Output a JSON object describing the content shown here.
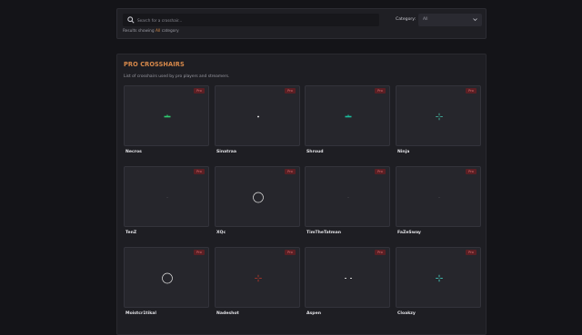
{
  "search": {
    "placeholder": "Search for a crosshair...",
    "category_label": "Category:",
    "category_value": "All",
    "results_prefix": "Results showing",
    "results_highlight": "All",
    "results_suffix": "category"
  },
  "section": {
    "title": "PRO CROSSHAIRS",
    "description": "List of crosshairs used by pro players and streamers."
  },
  "badge_label": "Pro",
  "crosshairs": [
    {
      "name": "Necros",
      "style": "dash-green",
      "color": "#2ecc71"
    },
    {
      "name": "Sinatraa",
      "style": "dot",
      "color": "#ffffff"
    },
    {
      "name": "Shroud",
      "style": "dash-teal",
      "color": "#1abc9c"
    },
    {
      "name": "Ninja",
      "style": "cross-teal",
      "color": "#48c9b0"
    },
    {
      "name": "TenZ",
      "style": "tiny-dot",
      "color": "#6b6b73"
    },
    {
      "name": "XQc",
      "style": "circle",
      "color": "#dddddd"
    },
    {
      "name": "TimTheTatman",
      "style": "tiny-dot",
      "color": "#6b6b73"
    },
    {
      "name": "FaZeSway",
      "style": "tiny-dot",
      "color": "#6b6b73"
    },
    {
      "name": "Moistcr1tikal",
      "style": "circle",
      "color": "#dddddd"
    },
    {
      "name": "Nadeshot",
      "style": "cross-red",
      "color": "#c0392b"
    },
    {
      "name": "Aspen",
      "style": "dash-white",
      "color": "#cfcfcf"
    },
    {
      "name": "Cloakzy",
      "style": "cross-cyan",
      "color": "#48e0d0"
    }
  ],
  "colors": {
    "accent": "#d8894a",
    "badge_bg": "#5b1f24",
    "badge_text": "#e07070"
  }
}
